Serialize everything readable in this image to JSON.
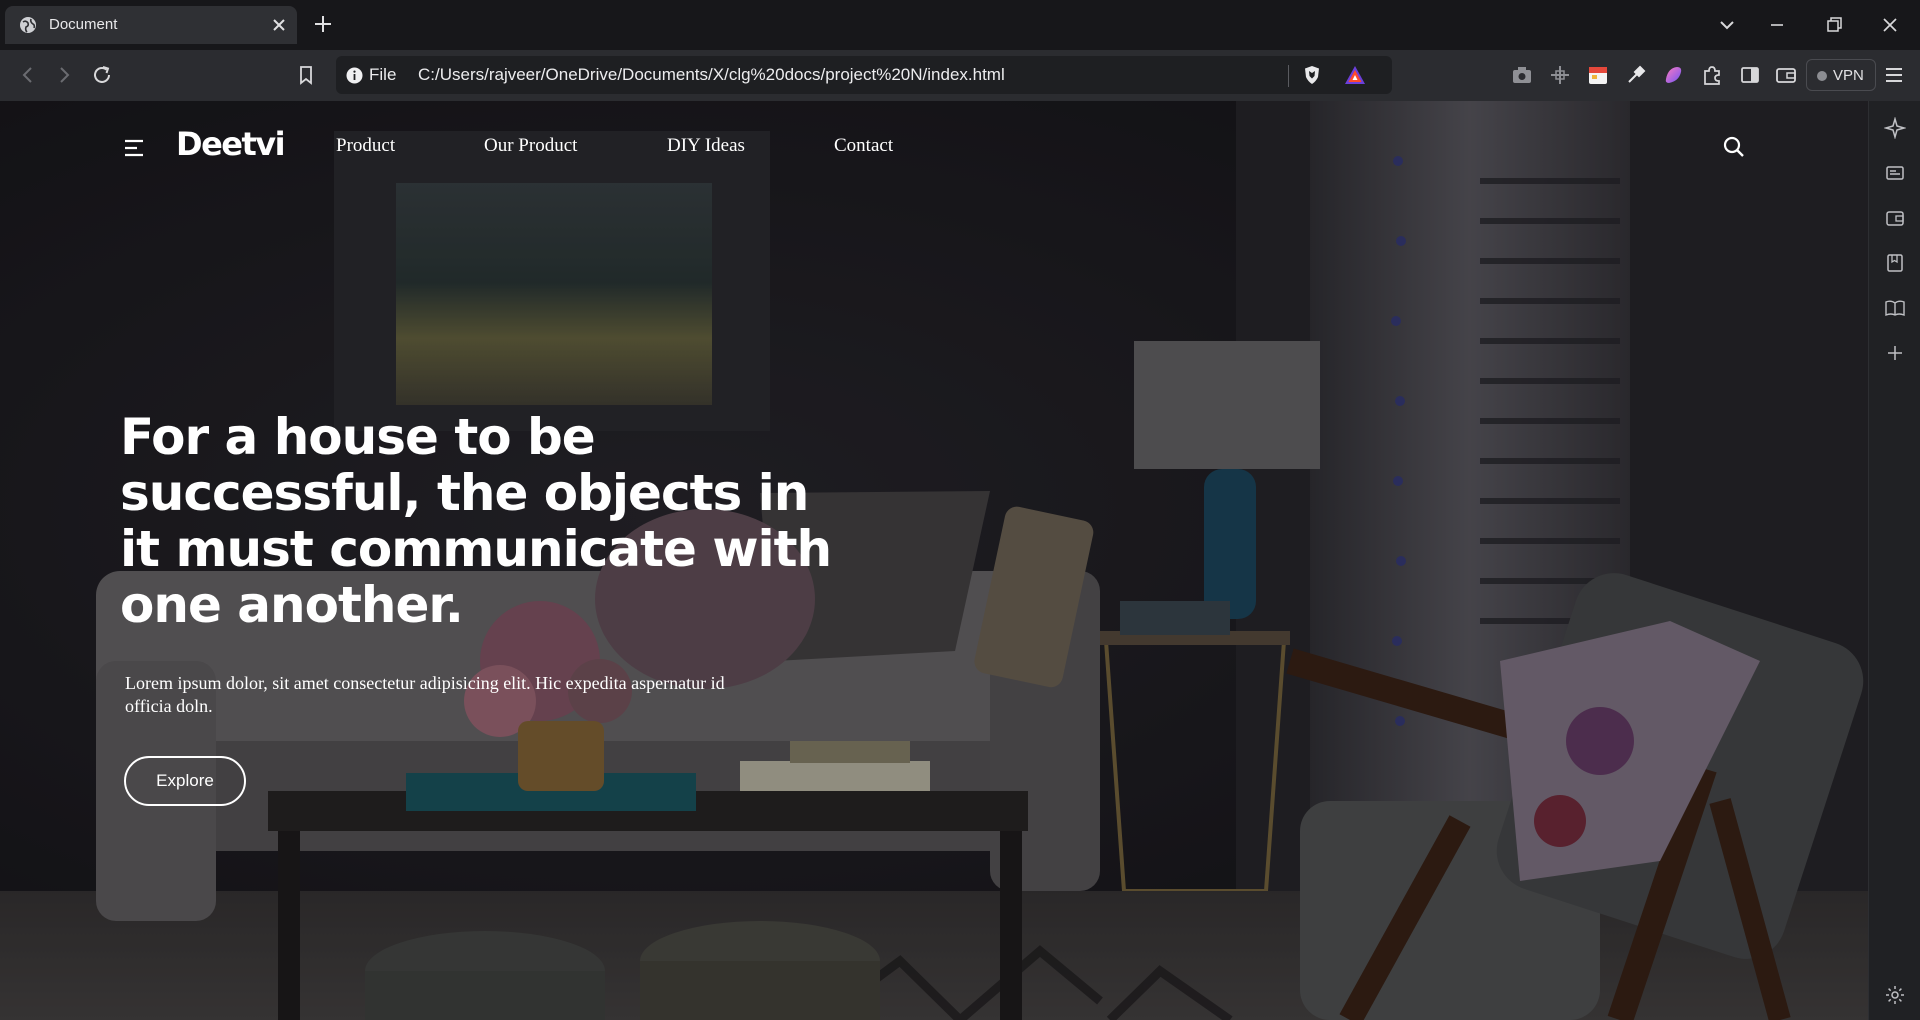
{
  "browser": {
    "tab": {
      "title": "Document",
      "favicon": "globe-icon"
    },
    "url": {
      "scheme": "File",
      "path": "C:/Users/rajveer/OneDrive/Documents/X/clg%20docs/project%20N/index.html"
    },
    "vpn_label": "VPN",
    "extension_icons": [
      "camera-icon",
      "crosshair-icon",
      "calendar-icon",
      "dropper-icon",
      "leo-icon",
      "puzzle-icon",
      "sidebar-icon",
      "wallet-icon"
    ],
    "side_panel_icons": [
      "leo-star-icon",
      "news-icon",
      "wallet-icon",
      "bookmarks-icon",
      "reading-list-icon",
      "add-icon",
      "settings-icon"
    ]
  },
  "site": {
    "logo": "Deetvi",
    "nav": [
      "Product",
      "Our Product",
      "DIY Ideas",
      "Contact"
    ],
    "hero": {
      "headline": "For a house to be successful, the objects in it must communicate with one another.",
      "subtext": "Lorem ipsum dolor, sit amet consectetur adipisicing elit. Hic expedita aspernatur id officia doln.",
      "cta": "Explore"
    }
  }
}
